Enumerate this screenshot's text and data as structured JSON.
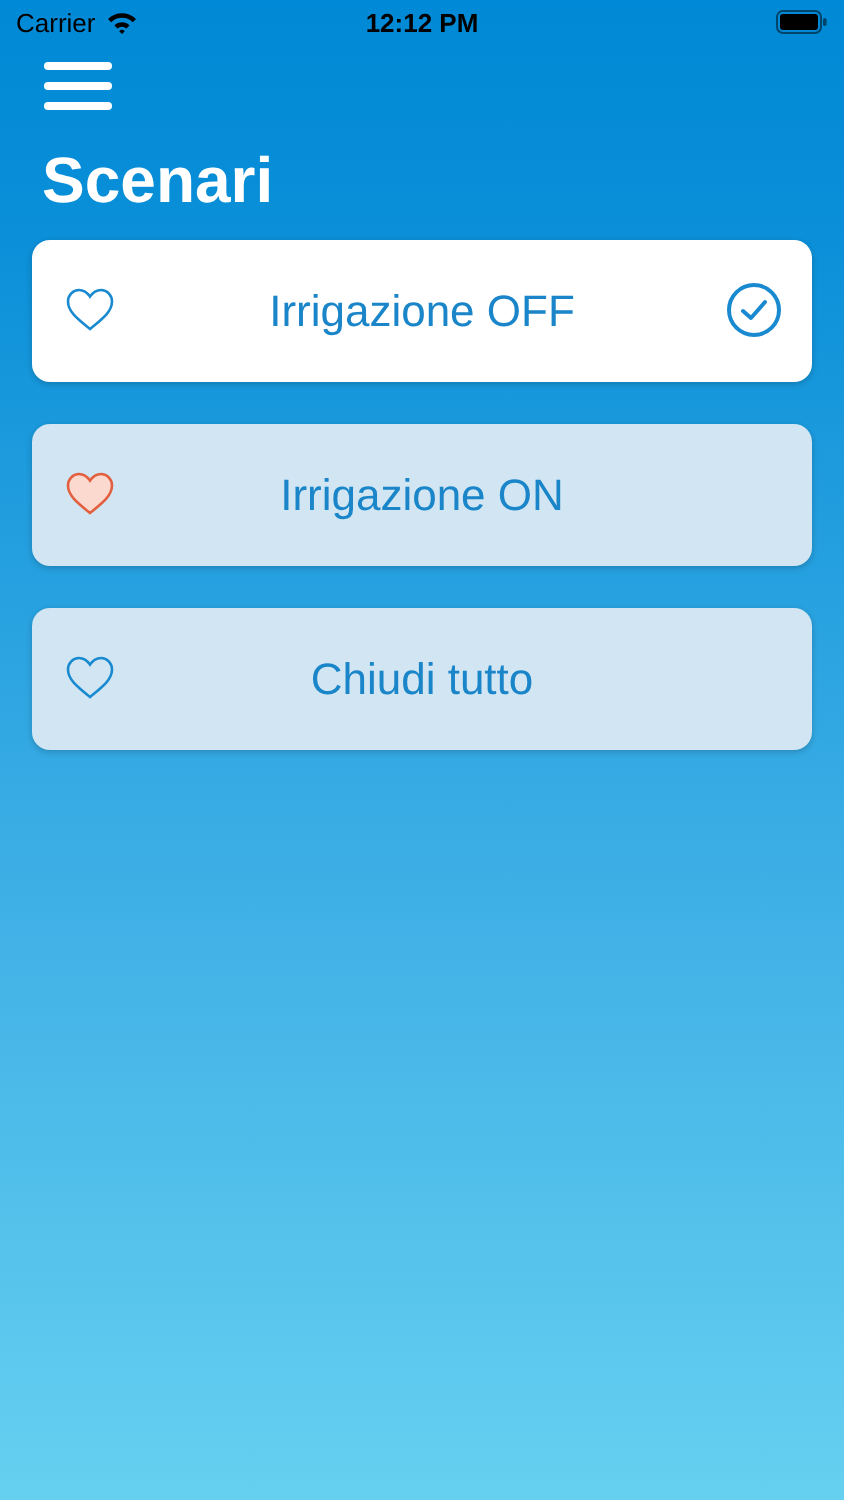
{
  "status_bar": {
    "carrier": "Carrier",
    "time": "12:12 PM"
  },
  "title": "Scenari",
  "scenarios": [
    {
      "label": "Irrigazione OFF",
      "selected": true,
      "favorite": false
    },
    {
      "label": "Irrigazione ON",
      "selected": false,
      "favorite": true
    },
    {
      "label": "Chiudi tutto",
      "selected": false,
      "favorite": false
    }
  ]
}
